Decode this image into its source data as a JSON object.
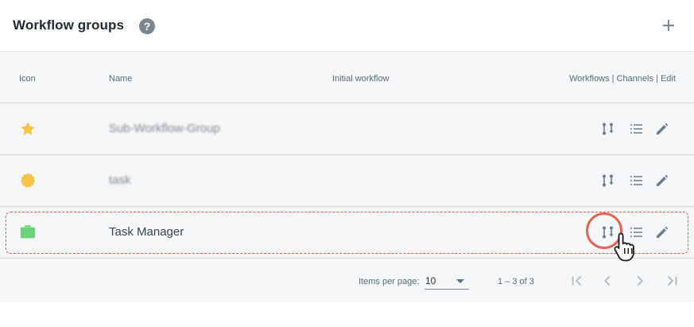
{
  "header": {
    "title": "Workflow groups",
    "help_icon": "help-circle-icon",
    "help_glyph": "?",
    "add_icon": "plus-icon"
  },
  "table": {
    "columns": {
      "icon": "Icon",
      "name": "Name",
      "initial_workflow": "Initial workflow",
      "actions": "Workflows | Channels | Edit"
    },
    "rows": [
      {
        "icon": "star-icon",
        "icon_color": "#f7c43c",
        "name": "Sub-Workflow-Group",
        "initial_workflow": ""
      },
      {
        "icon": "badge-icon",
        "icon_color": "#f6c24a",
        "name": "task",
        "initial_workflow": ""
      },
      {
        "icon": "briefcase-icon",
        "icon_color": "#6fd27a",
        "name": "Task Manager",
        "initial_workflow": ""
      }
    ]
  },
  "pagination": {
    "items_per_page_label": "Items per page:",
    "items_per_page_value": "10",
    "range": "1 – 3 of 3"
  },
  "colors": {
    "action_icon": "#6b7d88",
    "highlight": "#e05a4e"
  }
}
